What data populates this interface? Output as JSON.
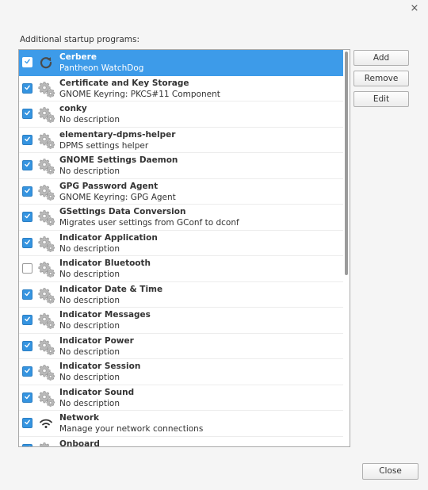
{
  "window": {
    "close_glyph": "×"
  },
  "section_label": "Additional startup programs:",
  "buttons": {
    "add": "Add",
    "remove": "Remove",
    "edit": "Edit",
    "close": "Close"
  },
  "programs": [
    {
      "name": "Cerbere",
      "description": "Pantheon WatchDog",
      "enabled": true,
      "selected": true,
      "icon": "refresh-icon"
    },
    {
      "name": "Certificate and Key Storage",
      "description": "GNOME Keyring: PKCS#11 Component",
      "enabled": true,
      "selected": false,
      "icon": "gears-icon"
    },
    {
      "name": "conky",
      "description": "No description",
      "enabled": true,
      "selected": false,
      "icon": "gears-icon"
    },
    {
      "name": "elementary-dpms-helper",
      "description": "DPMS settings helper",
      "enabled": true,
      "selected": false,
      "icon": "gears-icon"
    },
    {
      "name": "GNOME Settings Daemon",
      "description": "No description",
      "enabled": true,
      "selected": false,
      "icon": "gears-icon"
    },
    {
      "name": "GPG Password Agent",
      "description": "GNOME Keyring: GPG Agent",
      "enabled": true,
      "selected": false,
      "icon": "gears-icon"
    },
    {
      "name": "GSettings Data Conversion",
      "description": "Migrates user settings from GConf to dconf",
      "enabled": true,
      "selected": false,
      "icon": "gears-icon"
    },
    {
      "name": "Indicator Application",
      "description": "No description",
      "enabled": true,
      "selected": false,
      "icon": "gears-icon"
    },
    {
      "name": "Indicator Bluetooth",
      "description": "No description",
      "enabled": false,
      "selected": false,
      "icon": "gears-icon"
    },
    {
      "name": "Indicator Date & Time",
      "description": "No description",
      "enabled": true,
      "selected": false,
      "icon": "gears-icon"
    },
    {
      "name": "Indicator Messages",
      "description": "No description",
      "enabled": true,
      "selected": false,
      "icon": "gears-icon"
    },
    {
      "name": "Indicator Power",
      "description": "No description",
      "enabled": true,
      "selected": false,
      "icon": "gears-icon"
    },
    {
      "name": "Indicator Session",
      "description": "No description",
      "enabled": true,
      "selected": false,
      "icon": "gears-icon"
    },
    {
      "name": "Indicator Sound",
      "description": "No description",
      "enabled": true,
      "selected": false,
      "icon": "gears-icon"
    },
    {
      "name": "Network",
      "description": "Manage your network connections",
      "enabled": true,
      "selected": false,
      "icon": "wifi-icon"
    },
    {
      "name": "Onboard",
      "description": "",
      "enabled": true,
      "selected": false,
      "icon": "gears-icon"
    }
  ],
  "colors": {
    "selection": "#3d9be9",
    "checkbox": "#3594e0"
  }
}
